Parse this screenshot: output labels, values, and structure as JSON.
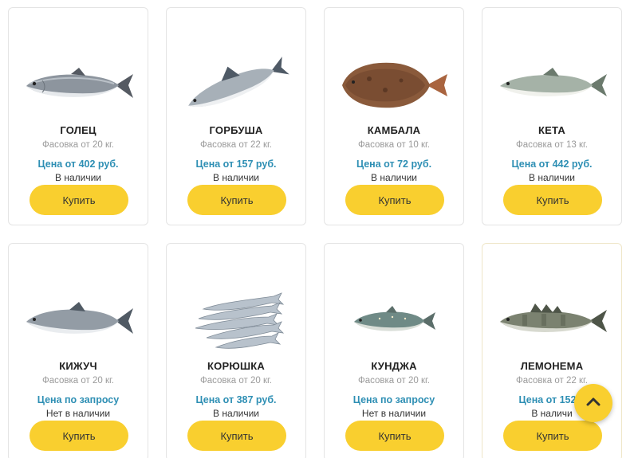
{
  "buy_label": "Купить",
  "accent_color": "#f9cf2f",
  "price_color": "#2e8fb4",
  "products": [
    {
      "name": "ГОЛЕЦ",
      "pack": "Фасовка от 20 кг.",
      "price": "Цена от 402 руб.",
      "stock": "В наличии",
      "icon": "char-fish-icon"
    },
    {
      "name": "ГОРБУША",
      "pack": "Фасовка от 22 кг.",
      "price": "Цена от 157 руб.",
      "stock": "В наличии",
      "icon": "pink-salmon-fish-icon"
    },
    {
      "name": "КАМБАЛА",
      "pack": "Фасовка от 10 кг.",
      "price": "Цена от 72 руб.",
      "stock": "В наличии",
      "icon": "flounder-fish-icon"
    },
    {
      "name": "КЕТА",
      "pack": "Фасовка от 13 кг.",
      "price": "Цена от 442 руб.",
      "stock": "В наличии",
      "icon": "chum-salmon-fish-icon"
    },
    {
      "name": "КИЖУЧ",
      "pack": "Фасовка от 20 кг.",
      "price": "Цена по запросу",
      "stock": "Нет в наличии",
      "icon": "coho-salmon-fish-icon"
    },
    {
      "name": "КОРЮШКА",
      "pack": "Фасовка от 20 кг.",
      "price": "Цена от 387 руб.",
      "stock": "В наличии",
      "icon": "smelt-fish-icon"
    },
    {
      "name": "КУНДЖА",
      "pack": "Фасовка от 20 кг.",
      "price": "Цена по запросу",
      "stock": "Нет в наличии",
      "icon": "kundzha-fish-icon"
    },
    {
      "name": "ЛЕМОНЕМА",
      "pack": "Фасовка от 22 кг.",
      "price": "Цена от 152 р",
      "stock": "В наличи",
      "icon": "lemonema-fish-icon"
    }
  ],
  "scroll_top_icon": "chevron-up-icon"
}
